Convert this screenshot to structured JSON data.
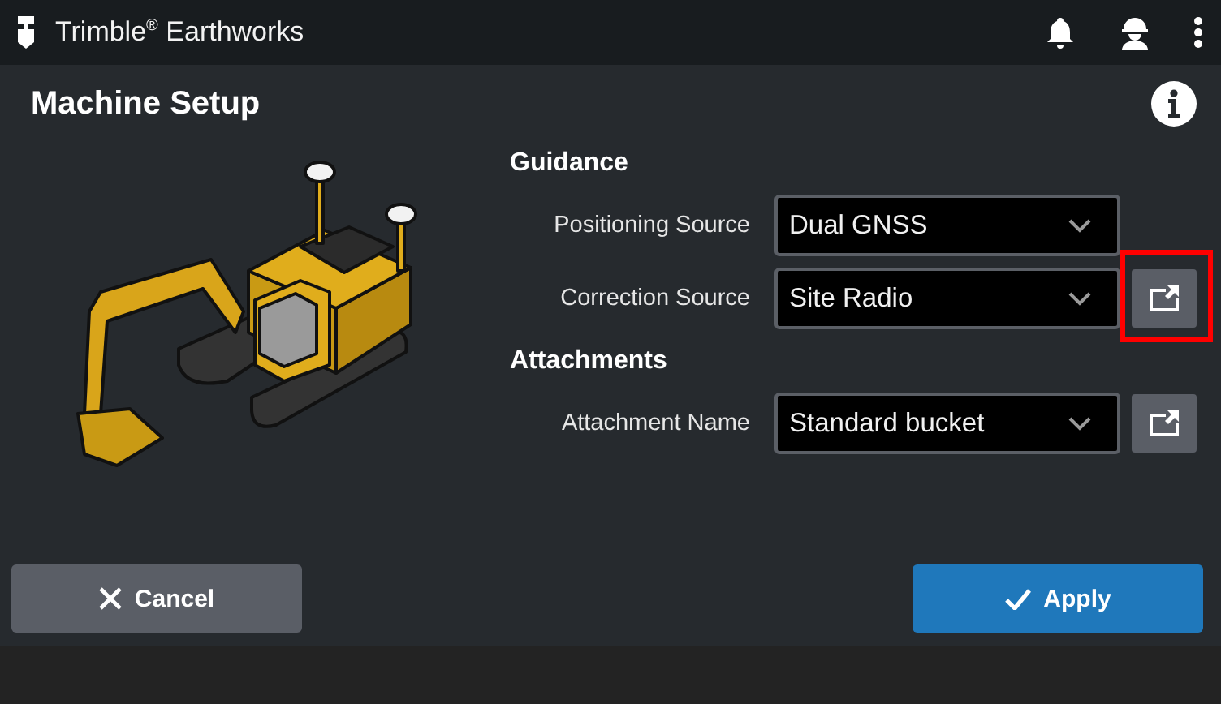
{
  "app": {
    "brand": "Trimble$^{®}$ Earthworks"
  },
  "page": {
    "title": "Machine Setup"
  },
  "sections": [
    {
      "title": "Guidance",
      "rows": [
        {
          "label": "Positioning Source",
          "value": "Dual GNSS",
          "has_link": false,
          "highlighted": false
        },
        {
          "label": "Correction Source",
          "value": "Site Radio",
          "has_link": true,
          "highlighted": true
        }
      ]
    },
    {
      "title": "Attachments",
      "rows": [
        {
          "label": "Attachment Name",
          "value": "Standard bucket",
          "has_link": true,
          "highlighted": false
        }
      ]
    }
  ],
  "buttons": [
    {
      "label": "Cancel",
      "kind": "cancel"
    },
    {
      "label": "Apply",
      "kind": "apply"
    }
  ]
}
